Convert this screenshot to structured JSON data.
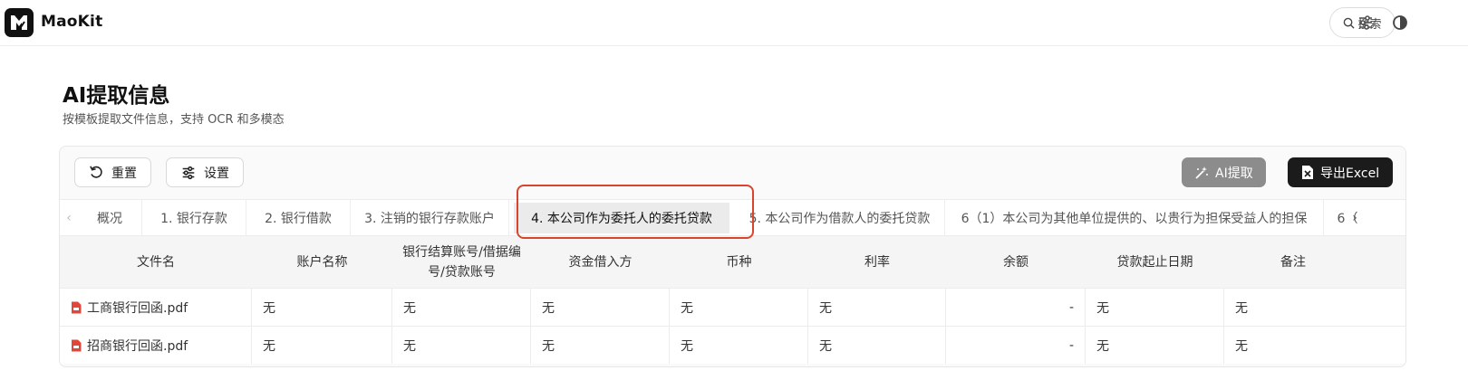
{
  "header": {
    "brand": "MaoKit",
    "search_label": "搜索",
    "icons": [
      "logo-icon",
      "search-icon",
      "sliders-icon",
      "contrast-icon"
    ]
  },
  "page": {
    "title": "AI提取信息",
    "subtitle": "按模板提取文件信息，支持 OCR 和多模态"
  },
  "toolbar": {
    "reset_label": "重置",
    "settings_label": "设置",
    "ai_label": "AI提取",
    "export_label": "导出Excel"
  },
  "tabs": [
    {
      "label": "概况"
    },
    {
      "label": "1. 银行存款"
    },
    {
      "label": "2. 银行借款"
    },
    {
      "label": "3. 注销的银行存款账户"
    },
    {
      "label": "4. 本公司作为委托人的委托贷款",
      "active": true
    },
    {
      "label": "5. 本公司作为借款人的委托贷款"
    },
    {
      "label": "6（1）本公司为其他单位提供的、以贵行为担保受益人的担保"
    },
    {
      "label": "6（"
    }
  ],
  "table": {
    "columns": [
      "文件名",
      "账户名称",
      "银行结算账号/借据编号/贷款账号",
      "资金借入方",
      "币种",
      "利率",
      "余额",
      "贷款起止日期",
      "备注"
    ],
    "rows": [
      [
        "工商银行回函.pdf",
        "无",
        "无",
        "无",
        "无",
        "无",
        "-",
        "无",
        "无"
      ],
      [
        "招商银行回函.pdf",
        "无",
        "无",
        "无",
        "无",
        "无",
        "-",
        "无",
        "无"
      ]
    ]
  },
  "colors": {
    "accent_highlight": "#d9442f",
    "ai_button": "#8c8c8c",
    "export_button": "#1b1b1b",
    "pdf_icon": "#e0463a"
  }
}
